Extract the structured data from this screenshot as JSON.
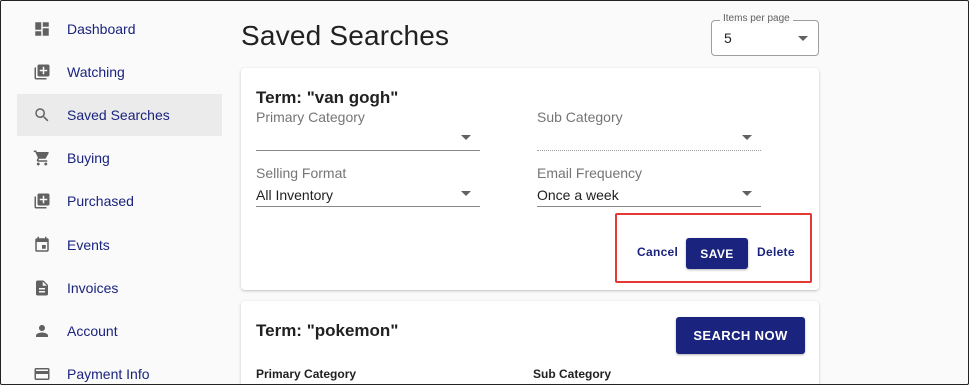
{
  "sidebar": {
    "items": [
      {
        "label": "Dashboard",
        "icon": "dashboard-icon",
        "active": false
      },
      {
        "label": "Watching",
        "icon": "add-box-icon",
        "active": false
      },
      {
        "label": "Saved Searches",
        "icon": "search-icon",
        "active": true
      },
      {
        "label": "Buying",
        "icon": "cart-icon",
        "active": false
      },
      {
        "label": "Purchased",
        "icon": "library-add-icon",
        "active": false
      },
      {
        "label": "Events",
        "icon": "calendar-icon",
        "active": false
      },
      {
        "label": "Invoices",
        "icon": "document-icon",
        "active": false
      },
      {
        "label": "Account",
        "icon": "person-icon",
        "active": false
      },
      {
        "label": "Payment Info",
        "icon": "credit-card-icon",
        "active": false
      }
    ]
  },
  "header": {
    "title": "Saved Searches",
    "items_per_page": {
      "label": "Items per page",
      "value": "5"
    }
  },
  "searches": [
    {
      "term": "Term: \"van gogh\"",
      "primary_category": {
        "label": "Primary Category",
        "value": ""
      },
      "sub_category": {
        "label": "Sub Category",
        "value": ""
      },
      "selling_format": {
        "label": "Selling Format",
        "value": "All Inventory"
      },
      "email_frequency": {
        "label": "Email Frequency",
        "value": "Once a week"
      },
      "actions": {
        "cancel": "Cancel",
        "save": "SAVE",
        "delete": "Delete"
      }
    },
    {
      "term": "Term: \"pokemon\"",
      "search_now": "SEARCH NOW",
      "primary_category_label": "Primary Category",
      "sub_category_label": "Sub Category"
    }
  ],
  "colors": {
    "accent": "#1a237e",
    "highlight": "#e53935",
    "active_bg": "#ebebeb"
  }
}
